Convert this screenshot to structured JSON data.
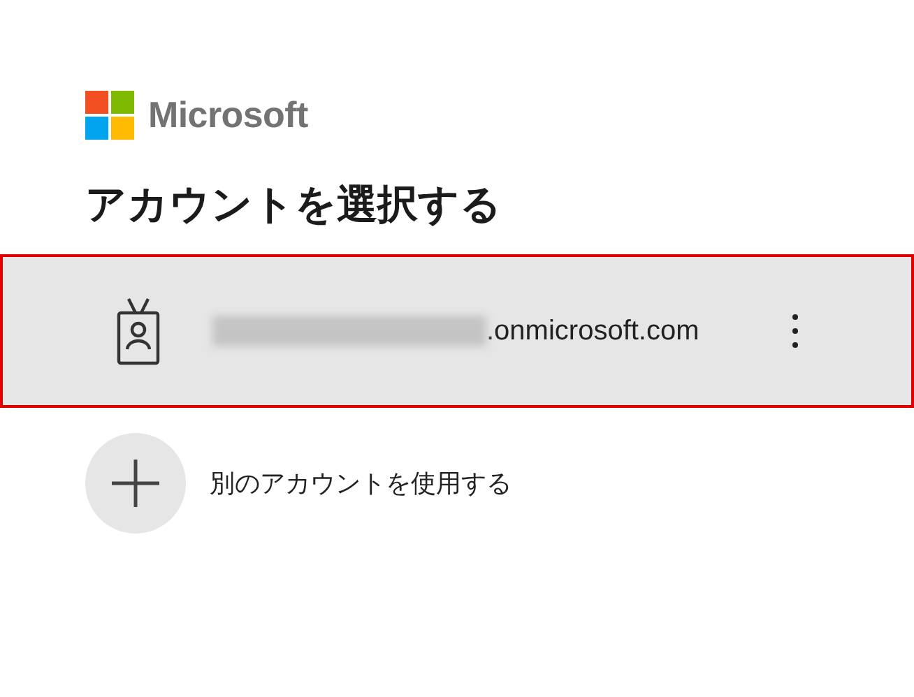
{
  "brand": {
    "name": "Microsoft"
  },
  "heading": "アカウントを選択する",
  "accounts": [
    {
      "kind": "account",
      "email_suffix": ".onmicrosoft.com",
      "selected": true
    },
    {
      "kind": "add",
      "label": "別のアカウントを使用する",
      "selected": false
    }
  ]
}
